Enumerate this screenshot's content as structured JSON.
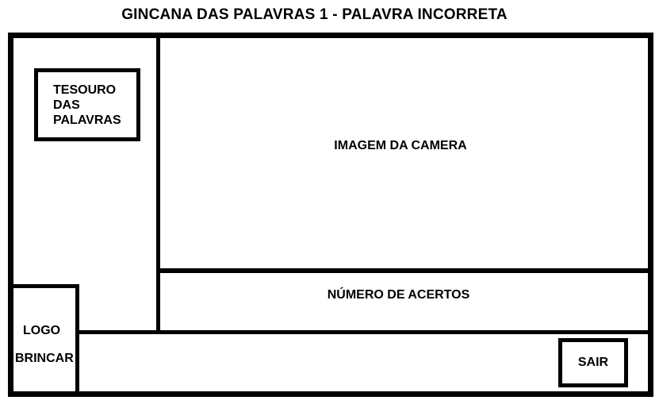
{
  "title": "GINCANA DAS PALAVRAS 1 - PALAVRA INCORRETA",
  "treasure_box": {
    "lines": [
      "TESOURO",
      "DAS",
      "PALAVRAS"
    ]
  },
  "camera_area": {
    "label": "IMAGEM DA CAMERA"
  },
  "hits_area": {
    "label": "NÚMERO DE ACERTOS"
  },
  "logo_box": {
    "line1": "LOGO",
    "line2": "BRINCAR"
  },
  "exit_button": {
    "label": "SAIR"
  }
}
